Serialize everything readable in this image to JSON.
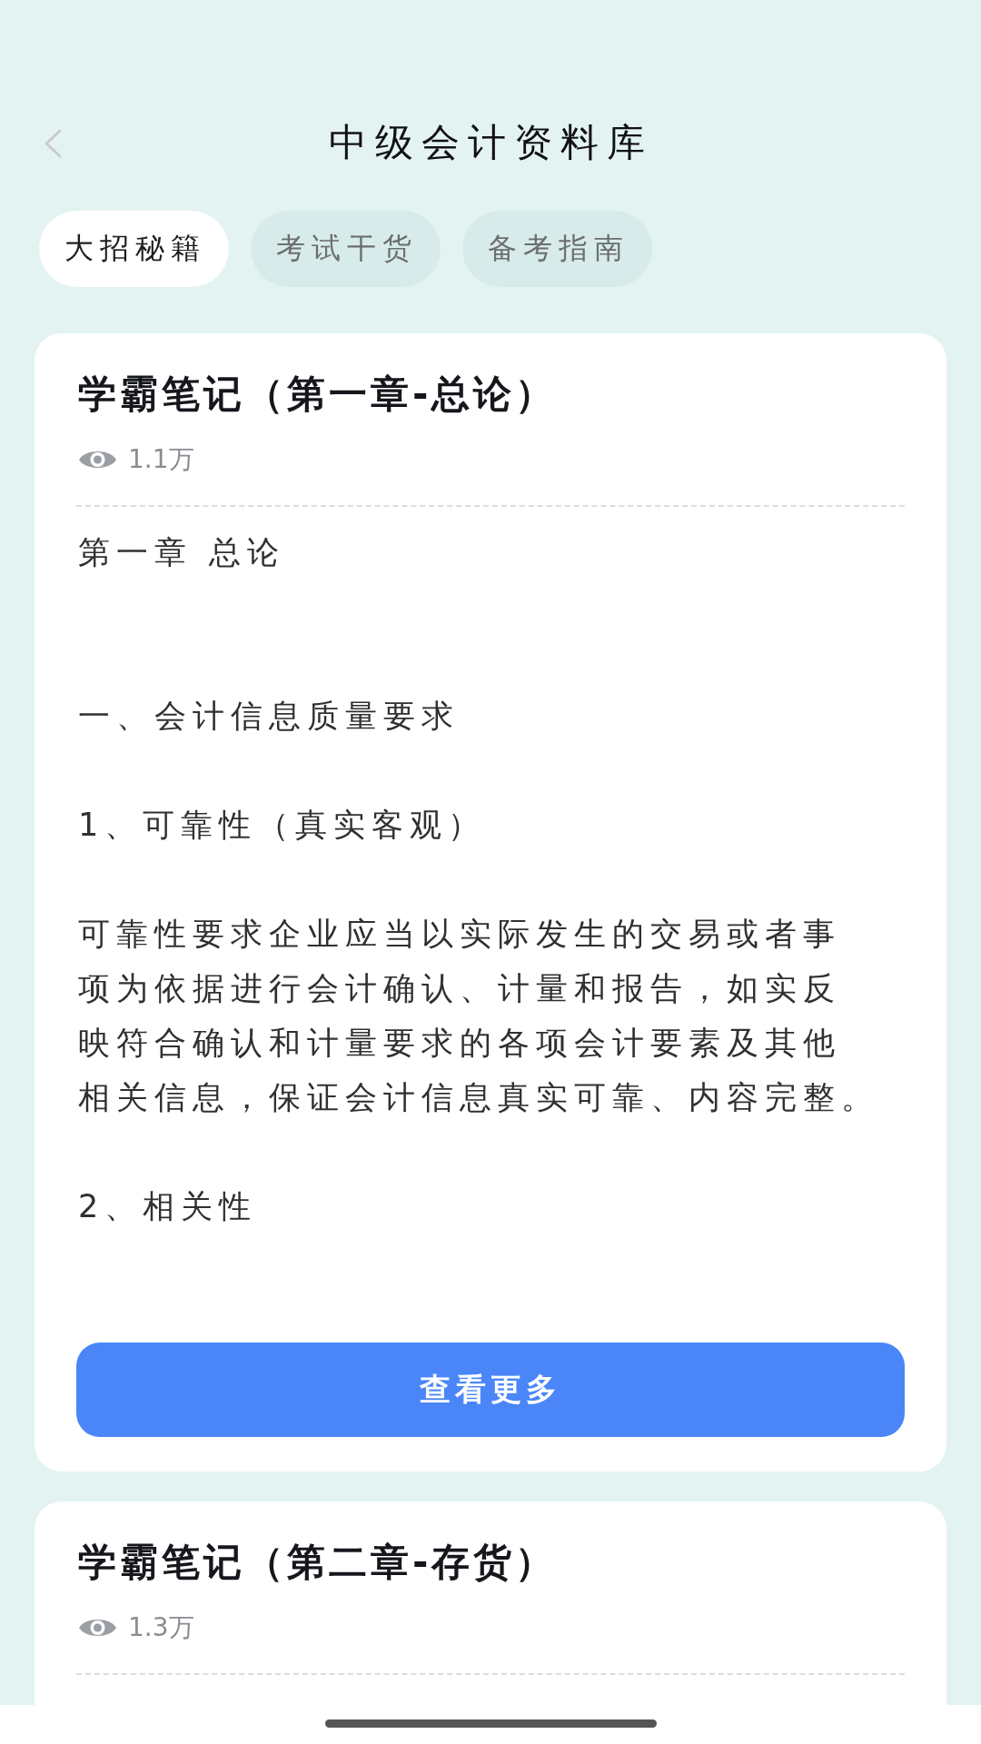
{
  "nav_bar": {
    "title": "中级会计资料库"
  },
  "tabs": [
    {
      "label": "大招秘籍",
      "selected": true
    },
    {
      "label": "考试干货",
      "selected": false
    },
    {
      "label": "备考指南",
      "selected": false
    }
  ],
  "articles": [
    {
      "title": "学霸笔记（第一章-总论）",
      "views": "1.1万",
      "content": [
        {
          "kind": "chapter",
          "text": "第一章 总论"
        },
        {
          "kind": "section",
          "text": "一、会计信息质量要求"
        },
        {
          "kind": "section",
          "text": "1、可靠性（真实客观）"
        },
        {
          "kind": "paragraph",
          "lines": [
            "可靠性要求企业应当以实际发生的交易或者事",
            "项为依据进行会计确认、计量和报告，如实反",
            "映符合确认和计量要求的各项会计要素及其他",
            "相关信息，保证会计信息真实可靠、内容完整。"
          ]
        },
        {
          "kind": "section",
          "text": "2、相关性"
        }
      ],
      "button": "查看更多"
    },
    {
      "title": "学霸笔记（第二章-存货）",
      "views": "1.3万"
    }
  ]
}
